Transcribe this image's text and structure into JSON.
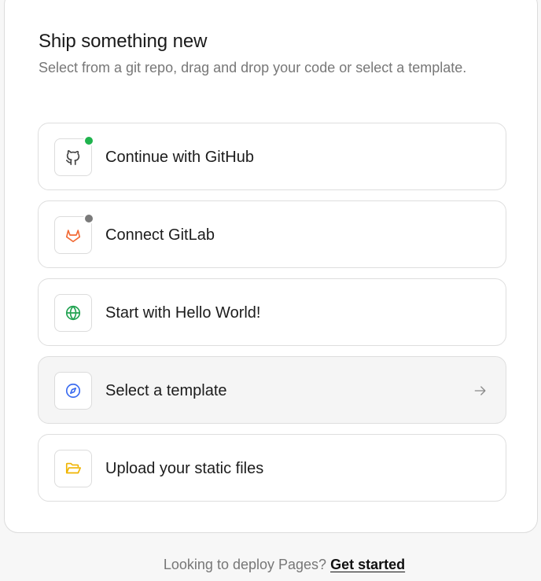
{
  "header": {
    "title": "Ship something new",
    "subtitle": "Select from a git repo, drag and drop your code or select a template."
  },
  "options": [
    {
      "label": "Continue with GitHub",
      "icon": "github-icon",
      "status": "connected",
      "status_color": "#1fb34d"
    },
    {
      "label": "Connect GitLab",
      "icon": "gitlab-icon",
      "status": "disconnected",
      "status_color": "#7a7a7a"
    },
    {
      "label": "Start with Hello World!",
      "icon": "globe-icon"
    },
    {
      "label": "Select a template",
      "icon": "compass-icon",
      "trailing_icon": "arrow-right-icon",
      "hovered": true
    },
    {
      "label": "Upload your static files",
      "icon": "folder-open-icon"
    }
  ],
  "footer": {
    "text": "Looking to deploy Pages?",
    "link_label": "Get started"
  },
  "colors": {
    "github": "#444444",
    "gitlab": "#f26a35",
    "globe": "#22a352",
    "compass": "#3b6cf0",
    "folder": "#f0b400"
  }
}
